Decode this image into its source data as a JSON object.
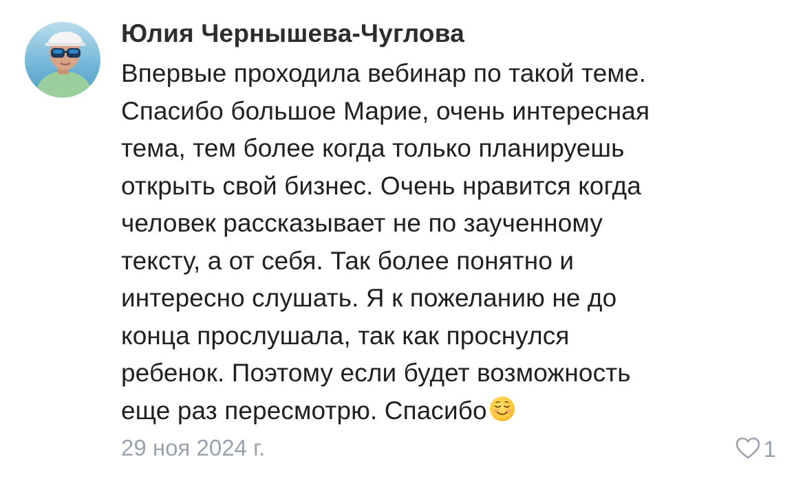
{
  "comment": {
    "author": "Юлия Чернышева-Чуглова",
    "lines": [
      "Впервые проходила вебинар по такой теме.",
      "Спасибо большое Марие, очень интересная",
      "тема, тем более когда только планируешь",
      "открыть свой бизнес. Очень нравится когда",
      "человек рассказывает не по заученному",
      "тексту, а от себя. Так более понятно и",
      "интересно слушать. Я к пожеланию не до",
      "конца прослушала, так как проснулся",
      "ребенок. Поэтому если будет возможность",
      "еще раз пересмотрю. Спасибо"
    ],
    "emoji": "smiling-face-emoji",
    "date": "29 ноя 2024 г.",
    "like_icon": "heart-outline-icon",
    "like_count": "1"
  },
  "colors": {
    "author": "#2c2d2e",
    "text": "#1f2021",
    "meta": "#99a2ad",
    "background": "#ffffff"
  }
}
